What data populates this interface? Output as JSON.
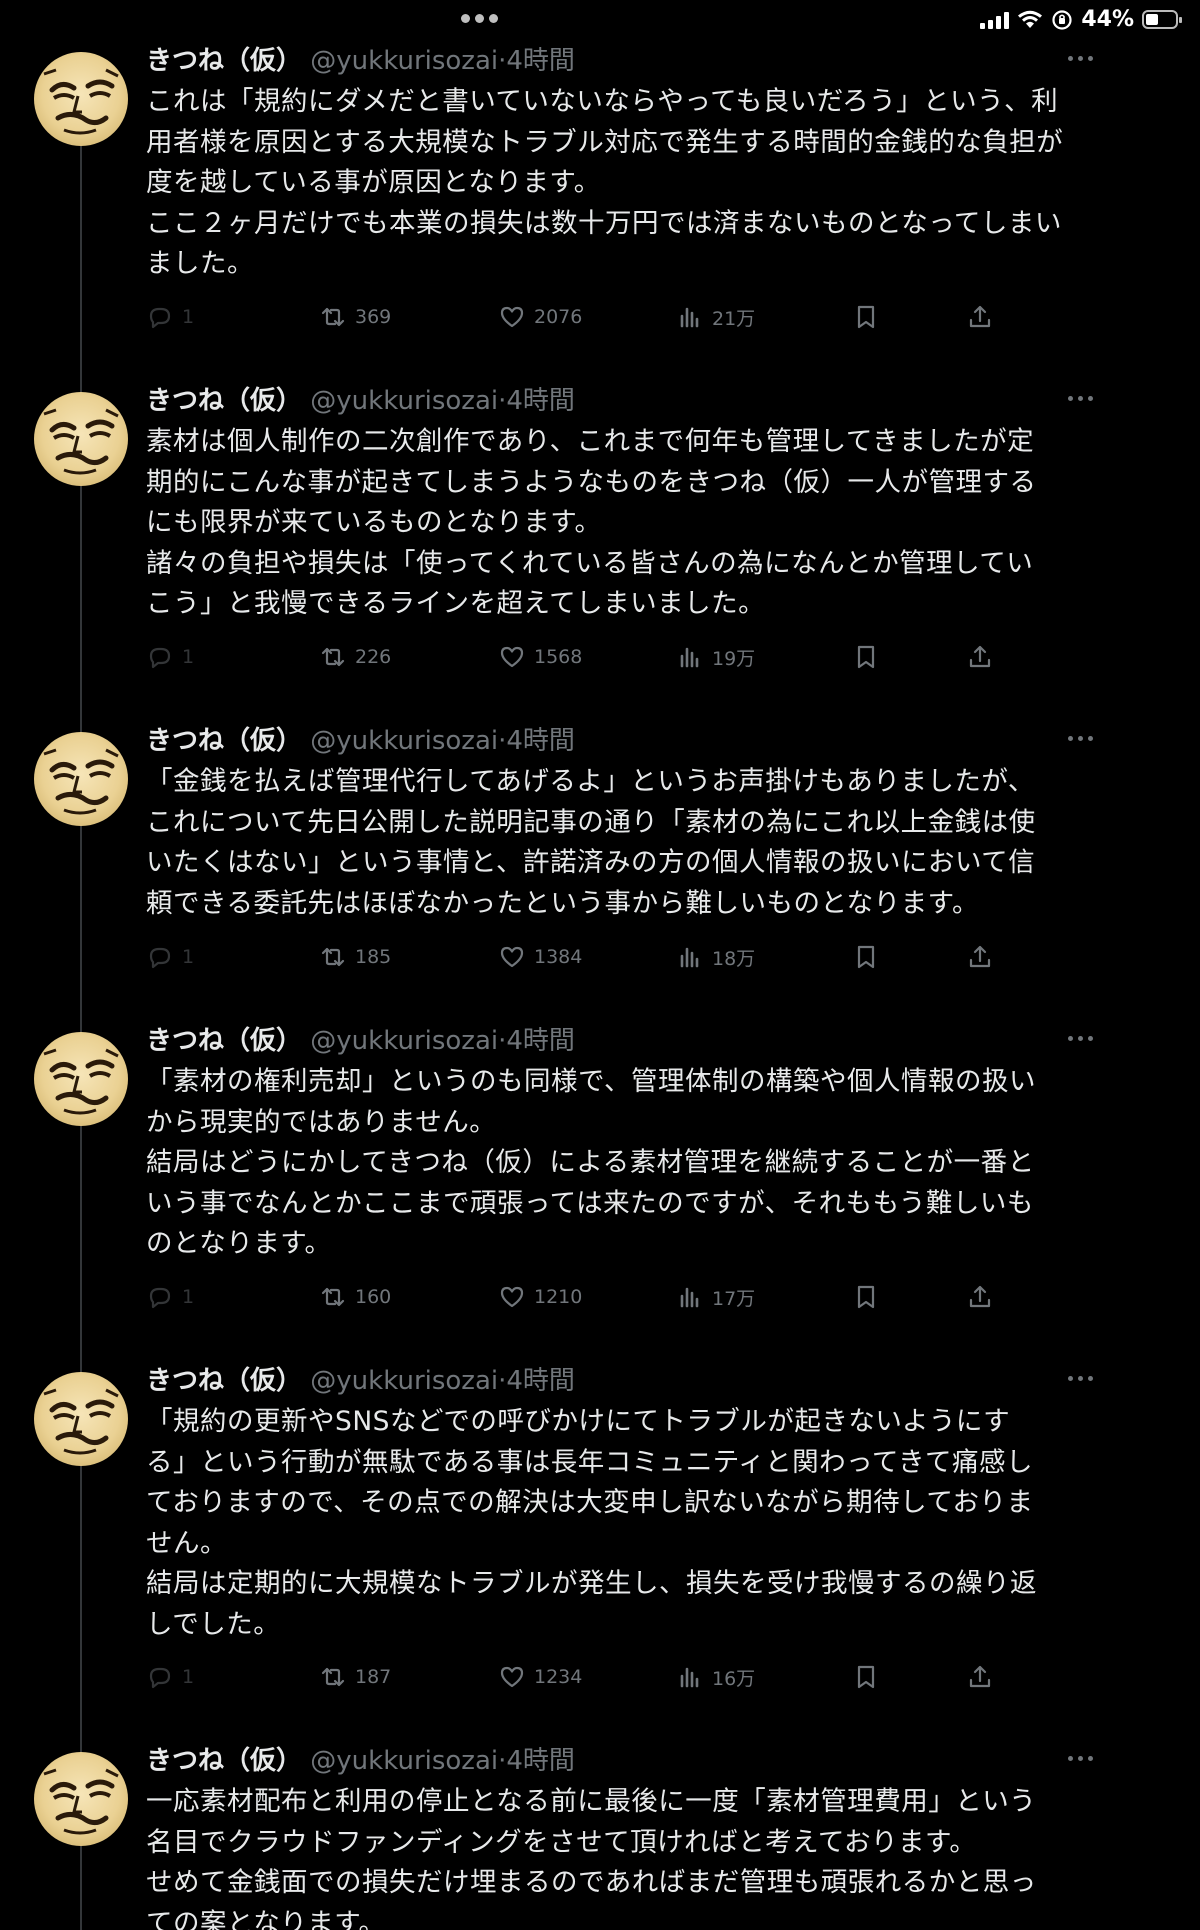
{
  "status_bar": {
    "battery_text": "44%",
    "battery_level": 0.44
  },
  "author": {
    "name": "きつね（仮）",
    "handle": "@yukkurisozai",
    "time": "4時間"
  },
  "tweets": [
    {
      "text": "これは「規約にダメだと書いていないならやっても良いだろう」という、利\n用者様を原因とする大規模なトラブル対応で発生する時間的金銭的な負担が\n度を越している事が原因となります。\nここ２ヶ月だけでも本業の損失は数十万円では済まないものとなってしまい\nました。",
      "replies": "1",
      "retweets": "369",
      "likes": "2076",
      "views": "21万"
    },
    {
      "text": "素材は個人制作の二次創作であり、これまで何年も管理してきましたが定\n期的にこんな事が起きてしまうようなものをきつね（仮）一人が管理する\nにも限界が来ているものとなります。\n諸々の負担や損失は「使ってくれている皆さんの為になんとか管理してい\nこう」と我慢できるラインを超えてしまいました。",
      "replies": "1",
      "retweets": "226",
      "likes": "1568",
      "views": "19万"
    },
    {
      "text": "「金銭を払えば管理代行してあげるよ」というお声掛けもありましたが、\nこれについて先日公開した説明記事の通り「素材の為にこれ以上金銭は使\nいたくはない」という事情と、許諾済みの方の個人情報の扱いにおいて信\n頼できる委託先はほぼなかったという事から難しいものとなります。",
      "replies": "1",
      "retweets": "185",
      "likes": "1384",
      "views": "18万"
    },
    {
      "text": "「素材の権利売却」というのも同様で、管理体制の構築や個人情報の扱い\nから現実的ではありません。\n結局はどうにかしてきつね（仮）による素材管理を継続することが一番と\nいう事でなんとかここまで頑張っては来たのですが、それももう難しいも\nのとなります。",
      "replies": "1",
      "retweets": "160",
      "likes": "1210",
      "views": "17万"
    },
    {
      "text": "「規約の更新やSNSなどでの呼びかけにてトラブルが起きないようにす\nる」という行動が無駄である事は長年コミュニティと関わってきて痛感し\nておりますので、その点での解決は大変申し訳ないながら期待しておりま\nせん。\n結局は定期的に大規模なトラブルが発生し、損失を受け我慢するの繰り返\nしでした。",
      "replies": "1",
      "retweets": "187",
      "likes": "1234",
      "views": "16万"
    },
    {
      "text": "一応素材配布と利用の停止となる前に最後に一度「素材管理費用」という\n名目でクラウドファンディングをさせて頂ければと考えております。\nせめて金銭面での損失だけ埋まるのであればまだ管理も頑張れるかと思っ\nての案となります。",
      "replies": "",
      "retweets": "",
      "likes": "",
      "views": ""
    }
  ]
}
